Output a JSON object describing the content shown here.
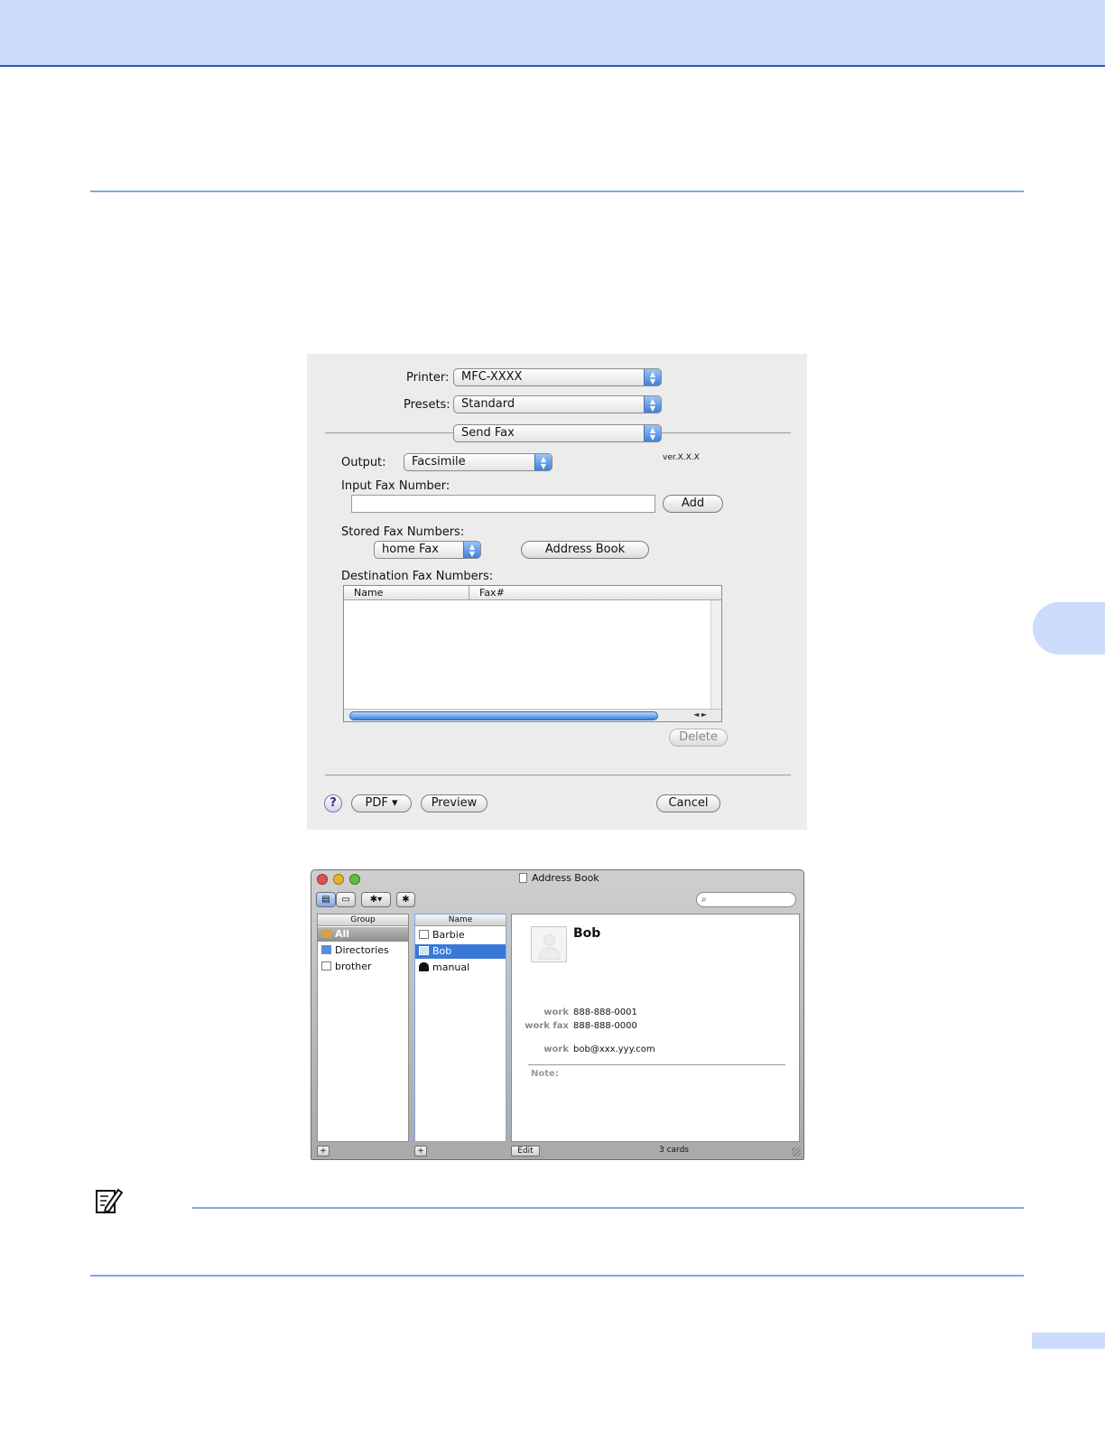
{
  "print_dialog": {
    "printer_label": "Printer:",
    "printer_value": "MFC-XXXX",
    "presets_label": "Presets:",
    "presets_value": "Standard",
    "panel_value": "Send Fax",
    "output_label": "Output:",
    "output_value": "Facsimile",
    "version": "ver.X.X.X",
    "input_fax_label": "Input Fax Number:",
    "input_fax_value": "",
    "add_button": "Add",
    "stored_label": "Stored Fax Numbers:",
    "stored_value": "home Fax",
    "address_book_button": "Address Book",
    "destination_label": "Destination Fax Numbers:",
    "table_headers": [
      "Name",
      "Fax#"
    ],
    "delete_button": "Delete",
    "help_button": "?",
    "pdf_button": "PDF ▾",
    "preview_button": "Preview",
    "cancel_button": "Cancel"
  },
  "address_book": {
    "title": "Address Book",
    "group_header": "Group",
    "groups": [
      "All",
      "Directories",
      "brother"
    ],
    "name_header": "Name",
    "names": [
      "Barbie",
      "Bob",
      "manual"
    ],
    "card": {
      "name": "Bob",
      "fields": [
        {
          "label": "work",
          "value": "888-888-0001"
        },
        {
          "label": "work fax",
          "value": "888-888-0000"
        },
        {
          "label": "work",
          "value": "bob@xxx.yyy.com"
        }
      ],
      "note_label": "Note:"
    },
    "edit_button": "Edit",
    "card_count": "3 cards",
    "add_symbol": "+"
  },
  "colors": {
    "band": "#cddcfb",
    "rule": "#7fa6e6",
    "selection_blue": "#3a78d8"
  }
}
